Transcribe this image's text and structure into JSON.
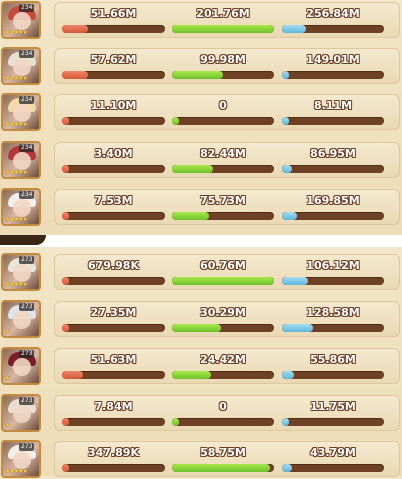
{
  "colors": {
    "damage": "#e06a48",
    "healing": "#86d438",
    "damage_taken": "#7ecbea",
    "bar_track": "#6e4124"
  },
  "top_panel": {
    "rows": [
      {
        "level": "234",
        "stars": "★★★★★",
        "damage": "51.66M",
        "damage_ratio": 0.25,
        "healing": "201.76M",
        "healing_ratio": 1.0,
        "taken": "256.84M",
        "taken_ratio": 0.24
      },
      {
        "level": "234",
        "stars": "★★★★★",
        "damage": "57.62M",
        "damage_ratio": 0.25,
        "healing": "99.98M",
        "healing_ratio": 0.5,
        "taken": "149.01M",
        "taken_ratio": 0.0
      },
      {
        "level": "234",
        "stars": "★★★★★",
        "damage": "11.10M",
        "damage_ratio": 0.03,
        "healing": "0",
        "healing_ratio": 0.0,
        "taken": "8.11M",
        "taken_ratio": 0.0
      },
      {
        "level": "234",
        "stars": "★★★★★",
        "damage": "3.40M",
        "damage_ratio": 0.0,
        "healing": "82.44M",
        "healing_ratio": 0.4,
        "taken": "86.95M",
        "taken_ratio": 0.1
      },
      {
        "level": "234",
        "stars": "★★★★★",
        "damage": "7.53M",
        "damage_ratio": 0.0,
        "healing": "75.73M",
        "healing_ratio": 0.36,
        "taken": "169.85M",
        "taken_ratio": 0.15
      }
    ]
  },
  "bottom_panel": {
    "rows": [
      {
        "level": "273",
        "stars": "★★★★★",
        "damage": "679.98K",
        "damage_ratio": 0.0,
        "healing": "60.76M",
        "healing_ratio": 1.0,
        "taken": "106.12M",
        "taken_ratio": 0.25
      },
      {
        "level": "273",
        "stars": "★",
        "damage": "27.35M",
        "damage_ratio": 0.0,
        "healing": "30.29M",
        "healing_ratio": 0.48,
        "taken": "128.58M",
        "taken_ratio": 0.3
      },
      {
        "level": "273",
        "stars": "★",
        "damage": "51.63M",
        "damage_ratio": 0.2,
        "healing": "24.42M",
        "healing_ratio": 0.38,
        "taken": "55.86M",
        "taken_ratio": 0.12
      },
      {
        "level": "273",
        "stars": "★",
        "damage": "7.84M",
        "damage_ratio": 0.0,
        "healing": "0",
        "healing_ratio": 0.0,
        "taken": "11.75M",
        "taken_ratio": 0.0
      },
      {
        "level": "273",
        "stars": "★★★★★",
        "damage": "347.89K",
        "damage_ratio": 0.0,
        "healing": "58.75M",
        "healing_ratio": 0.96,
        "taken": "43.79M",
        "taken_ratio": 0.1
      }
    ]
  }
}
